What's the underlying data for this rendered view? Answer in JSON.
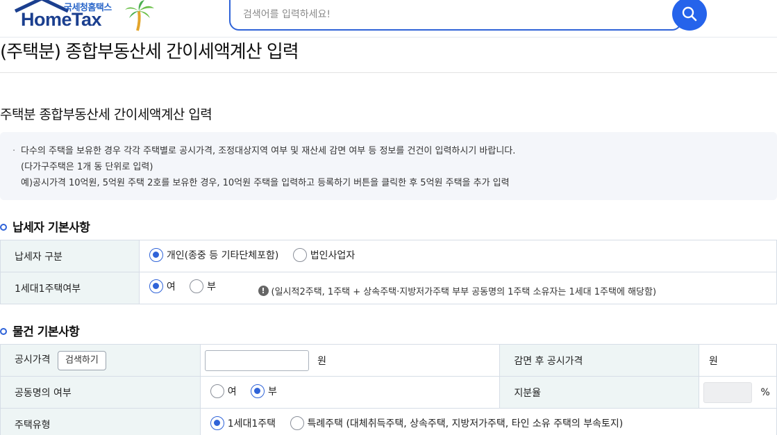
{
  "header": {
    "logo_sub": "국세청홈택스",
    "logo_main": "HomeTax",
    "search_placeholder": "검색어를 입력하세요!"
  },
  "page_title": "(주택분) 종합부동산세 간이세액계산 입력",
  "section_title": "주택분 종합부동산세 간이세액계산 입력",
  "info": {
    "line1": "다수의 주택을 보유한 경우 각각 주택별로 공시가격, 조정대상지역 여부 및 재산세 감면 여부 등 정보를 건건이 입력하시기 바랍니다.",
    "line2": "(다가구주택은 1개 동 단위로 입력)",
    "line3": "예)공시가격 10억원, 5억원 주택 2호를 보유한 경우, 10억원 주택을 입력하고 등록하기 버튼을 클릭한 후 5억원 주택을 추가 입력"
  },
  "taxpayer": {
    "heading": "납세자 기본사항",
    "type_label": "납세자 구분",
    "type_options": [
      "개인(종중 등 기타단체포함)",
      "법인사업자"
    ],
    "type_selected": 0,
    "one_house_label": "1세대1주택여부",
    "one_house_options": [
      "여",
      "부"
    ],
    "one_house_selected": 0,
    "note": "(일시적2주택, 1주택 + 상속주택·지방저가주택 부부 공동명의 1주택 소유자는 1세대 1주택에 해당함)"
  },
  "property": {
    "heading": "물건 기본사항",
    "price_label": "공시가격",
    "search_button": "검색하기",
    "won": "원",
    "reduced_price_label": "감면 후 공시가격",
    "joint_label": "공동명의 여부",
    "joint_options": [
      "여",
      "부"
    ],
    "joint_selected": 1,
    "share_label": "지분율",
    "percent": "%",
    "house_type_label": "주택유형",
    "house_type_options": [
      "1세대1주택",
      "특례주택 (대체취득주택, 상속주택, 지방저가주택, 타인 소유 주택의 부속토지)"
    ],
    "house_type_selected": 0
  },
  "colors": {
    "accent": "#2f63d8",
    "header_cell": "#eef5f5",
    "info_bg": "#f4f6fa"
  }
}
